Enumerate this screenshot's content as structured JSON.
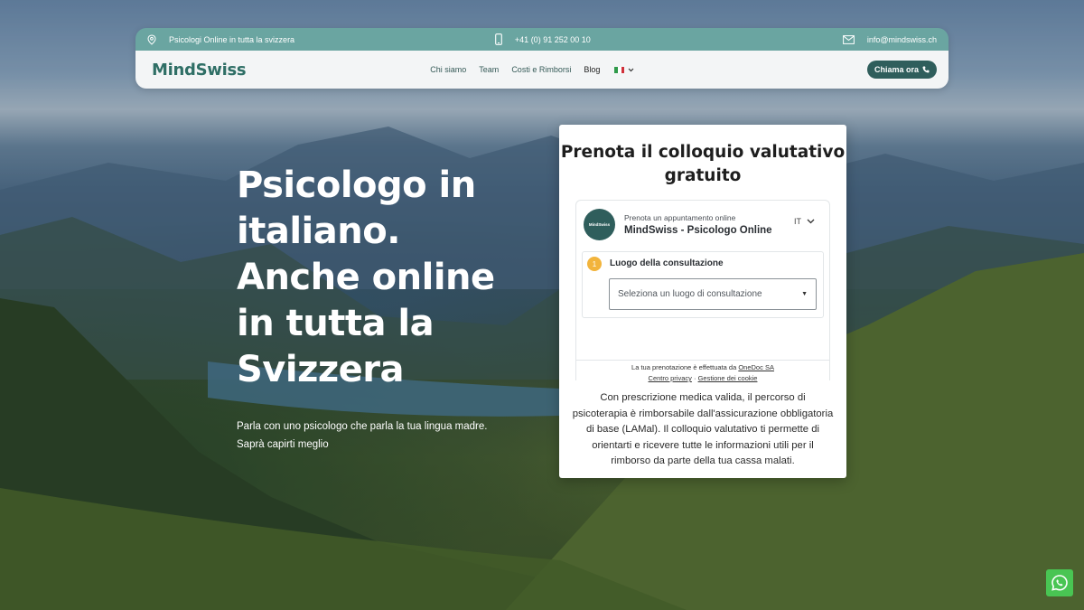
{
  "infobar": {
    "location": "Psicologi Online in tutta la svizzera",
    "phone": "+41 (0) 91 252 00 10",
    "email": "info@mindswiss.ch",
    "location_icon": "map-pin-icon",
    "phone_icon": "smartphone-icon",
    "email_icon": "envelope-icon"
  },
  "navbar": {
    "logo": "MindSwiss",
    "items": [
      "Chi siamo",
      "Team",
      "Costi e Rimborsi",
      "Blog"
    ],
    "call_label": "Chiama ora"
  },
  "hero": {
    "title": "Psicologo in italiano. Anche online in tutta la Svizzera",
    "subtitle": "Parla con uno psicologo che parla la tua lingua madre. Saprà capirti meglio"
  },
  "booking": {
    "title": "Prenota il colloquio valutativo gratuito",
    "widget": {
      "avatar_text": "MindSwiss",
      "small_label": "Prenota un appuntamento online",
      "provider_name": "MindSwiss - Psicologo Online",
      "language": "IT",
      "step_number": "1",
      "step_label": "Luogo della consultazione",
      "select_placeholder": "Seleziona un luogo di consultazione"
    },
    "powered_prefix": "La tua prenotazione è effettuata da",
    "powered_link": "OneDoc SA",
    "privacy_link": "Centro privacy",
    "cookie_link": "Gestione dei cookie",
    "description": "Con prescrizione medica valida, il percorso di psicoterapia è rimborsabile dall'assicurazione obbligatoria di base (LAMal). Il colloquio valutativo ti permette di orientarti e ricevere tutte le informazioni utili per il rimborso da parte della tua cassa malati."
  },
  "colors": {
    "accent": "#2f5e5c",
    "infobar": "#6aa5a1",
    "logo": "#2f6f66",
    "whatsapp": "#49c553"
  }
}
